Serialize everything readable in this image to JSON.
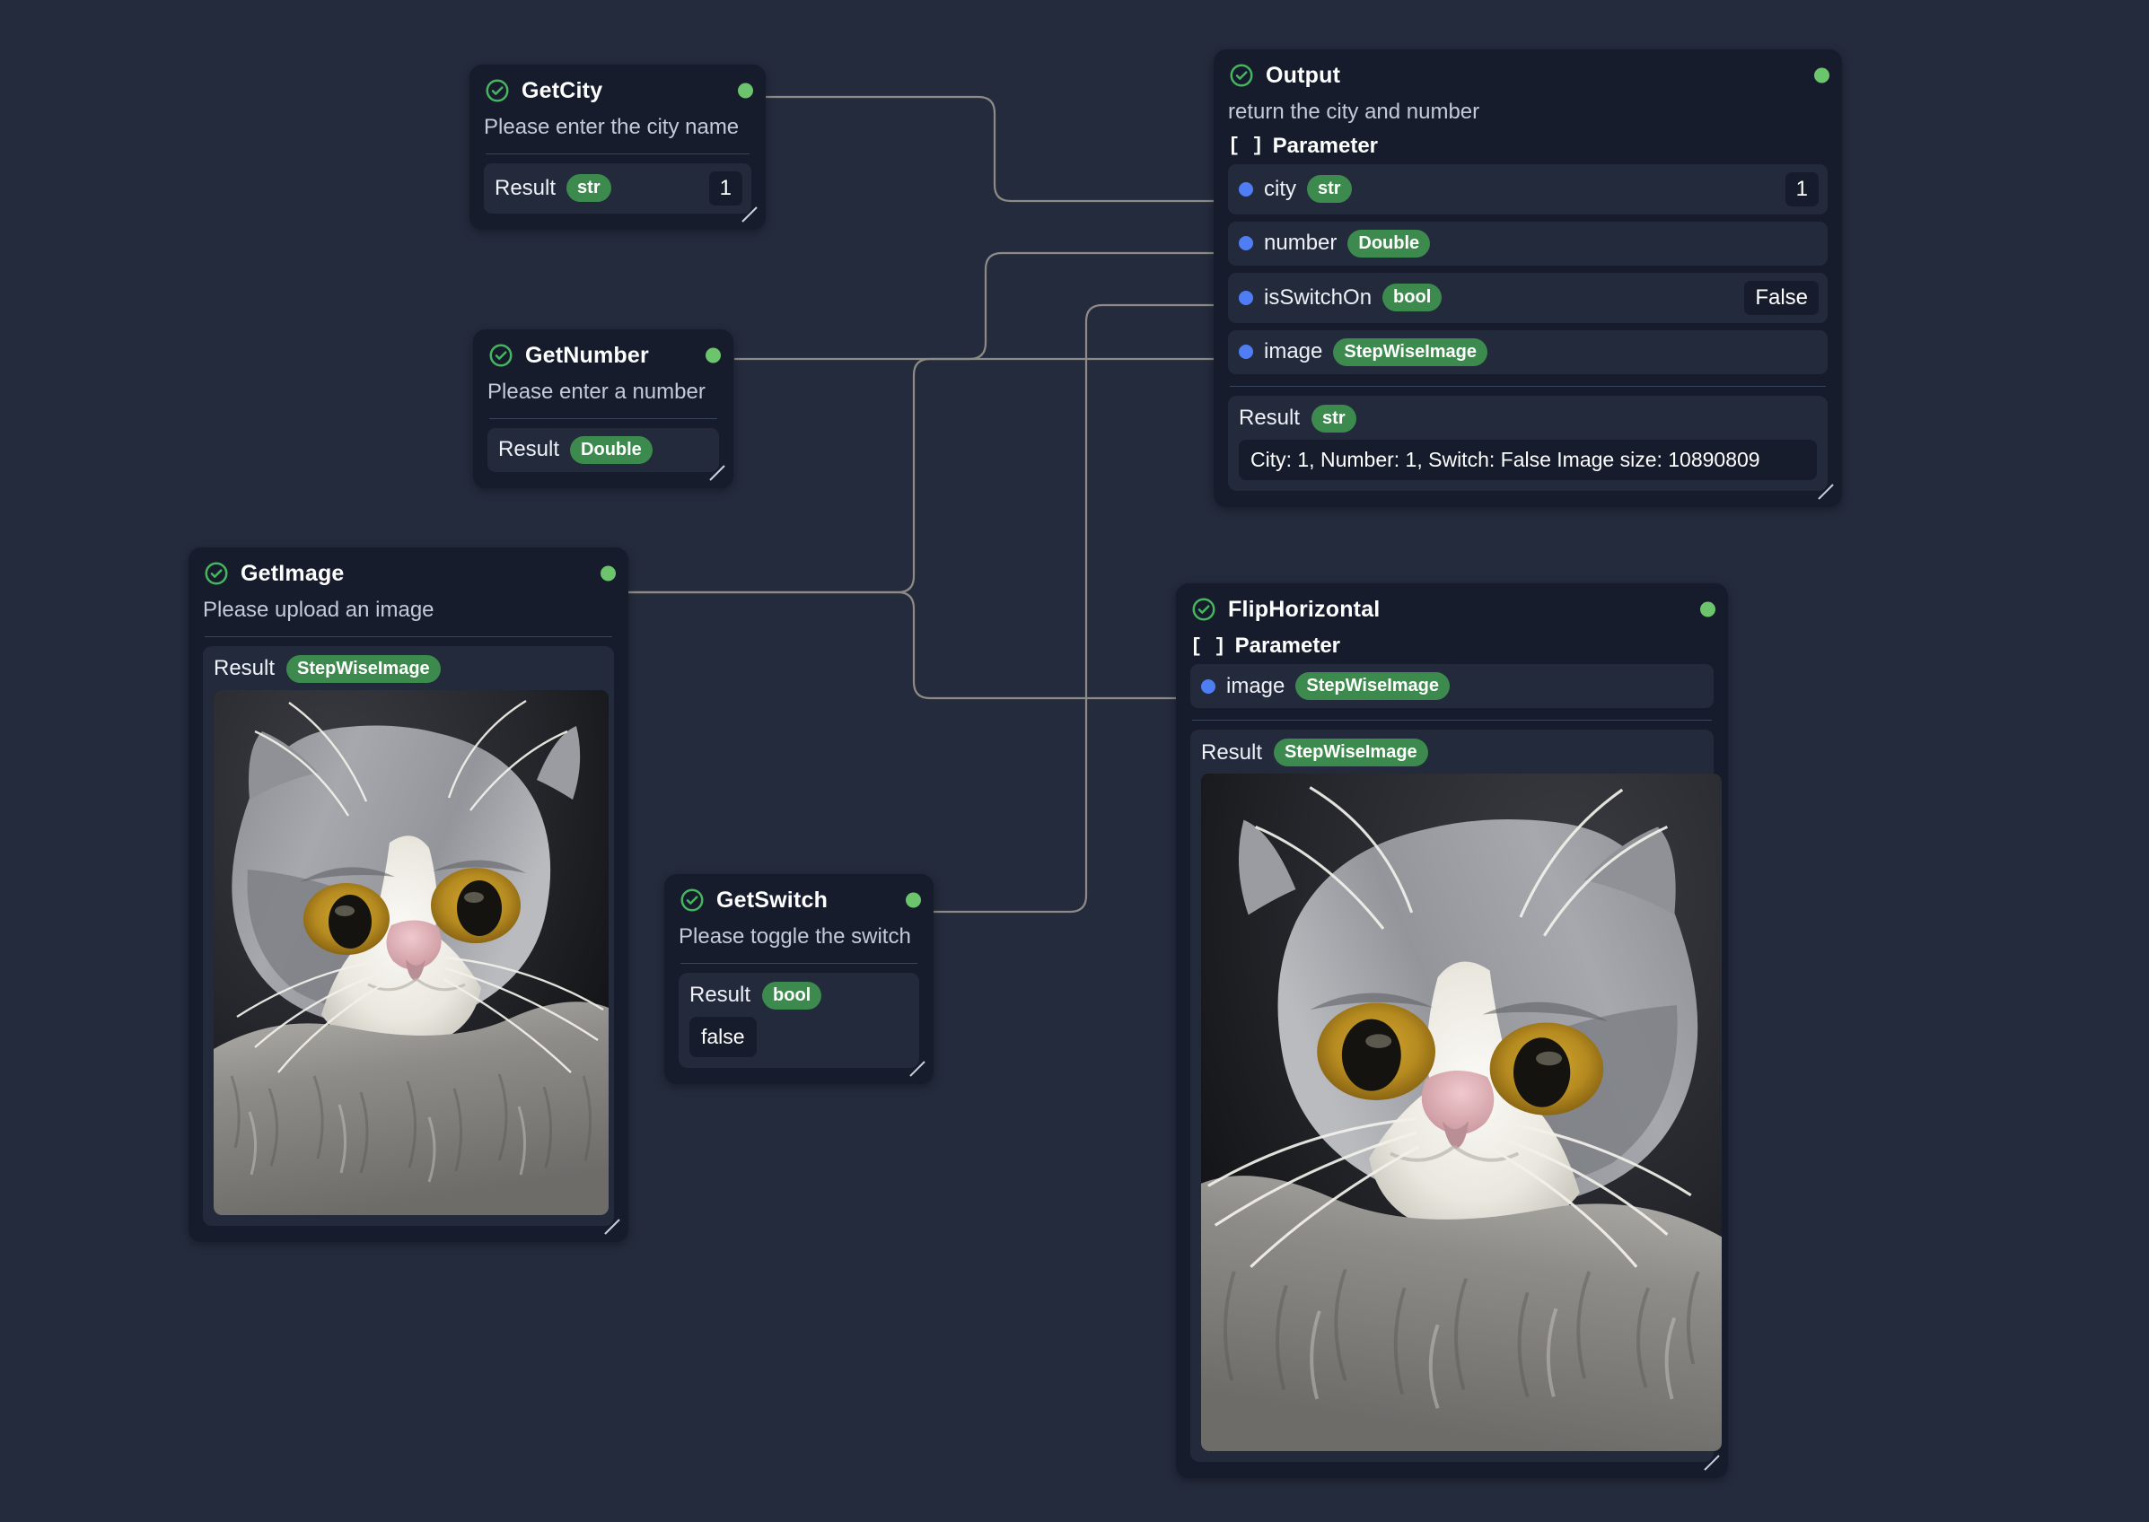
{
  "theme": {
    "canvas_bg": "#242b3d",
    "node_bg": "#161c2c",
    "row_bg": "#222a3c",
    "badge_green": "#3d8a4e",
    "port_out_green": "#6cc56c",
    "port_in_blue": "#4f7df3",
    "edge_color": "#8d8b84"
  },
  "icons": {
    "status": "check-circle-icon",
    "parameter": "brackets-icon",
    "resize": "resize-grip-icon",
    "output_port": "output-port-dot",
    "input_port": "input-port-dot"
  },
  "nodes": [
    {
      "id": "getcity",
      "title": "GetCity",
      "description": "Please enter the city name",
      "result": {
        "label": "Result",
        "type": "str",
        "value": "1"
      }
    },
    {
      "id": "getnumber",
      "title": "GetNumber",
      "description": "Please enter a number",
      "result": {
        "label": "Result",
        "type": "Double",
        "value": ""
      }
    },
    {
      "id": "getimage",
      "title": "GetImage",
      "description": "Please upload an image",
      "result": {
        "label": "Result",
        "type": "StepWiseImage",
        "value": ""
      }
    },
    {
      "id": "getswitch",
      "title": "GetSwitch",
      "description": "Please toggle the switch",
      "result": {
        "label": "Result",
        "type": "bool",
        "value": "false"
      }
    },
    {
      "id": "output",
      "title": "Output",
      "description": "return the city and number",
      "parameter_label": "Parameter",
      "parameters": [
        {
          "name": "city",
          "type": "str",
          "value": "1"
        },
        {
          "name": "number",
          "type": "Double",
          "value": ""
        },
        {
          "name": "isSwitchOn",
          "type": "bool",
          "value": "False"
        },
        {
          "name": "image",
          "type": "StepWiseImage",
          "value": ""
        }
      ],
      "result": {
        "label": "Result",
        "type": "str",
        "value": "City: 1, Number: 1, Switch: False Image size: 10890809"
      }
    },
    {
      "id": "fliphorizontal",
      "title": "FlipHorizontal",
      "description": "",
      "parameter_label": "Parameter",
      "parameters": [
        {
          "name": "image",
          "type": "StepWiseImage",
          "value": ""
        }
      ],
      "result": {
        "label": "Result",
        "type": "StepWiseImage",
        "value": ""
      }
    }
  ]
}
